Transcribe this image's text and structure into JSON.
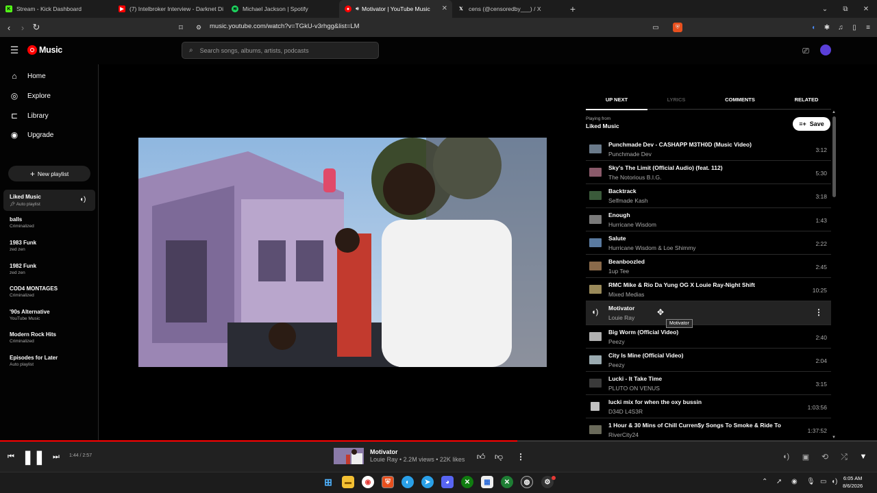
{
  "browser": {
    "tabs": [
      {
        "title": "Stream - Kick Dashboard",
        "active": false
      },
      {
        "title": "(7) Intelbroker Interview - Darknet Di",
        "active": false
      },
      {
        "title": "Michael Jackson | Spotify",
        "active": false
      },
      {
        "title": "Motivator | YouTube Music",
        "active": true
      },
      {
        "title": "cens (@censoredby___) / X",
        "active": false
      }
    ],
    "url": "music.youtube.com/watch?v=TGkU-v3rhgg&list=LM"
  },
  "header": {
    "logo_text": "Music",
    "search_placeholder": "Search songs, albums, artists, podcasts"
  },
  "sidebar": {
    "nav": [
      {
        "label": "Home",
        "icon": "home-icon"
      },
      {
        "label": "Explore",
        "icon": "explore-icon"
      },
      {
        "label": "Library",
        "icon": "library-icon"
      },
      {
        "label": "Upgrade",
        "icon": "upgrade-icon"
      }
    ],
    "new_playlist": "New playlist",
    "playlists": [
      {
        "title": "Liked Music",
        "subtitle": "Auto playlist"
      },
      {
        "title": "balls",
        "subtitle": "Criminalized"
      },
      {
        "title": "1983 Funk",
        "subtitle": "zed zen"
      },
      {
        "title": "1982 Funk",
        "subtitle": "zed zen"
      },
      {
        "title": "COD4 MONTAGES",
        "subtitle": "Criminalized"
      },
      {
        "title": "'90s Alternative",
        "subtitle": "YouTube Music"
      },
      {
        "title": "Modern Rock Hits",
        "subtitle": "Criminalized"
      },
      {
        "title": "Episodes for Later",
        "subtitle": "Auto playlist"
      }
    ]
  },
  "panel": {
    "tabs": [
      "UP NEXT",
      "LYRICS",
      "COMMENTS",
      "RELATED"
    ],
    "playing_from_label": "Playing from",
    "playing_from": "Liked Music",
    "save_label": "Save",
    "queue": [
      {
        "title": "Punchmade Dev - CASHAPP M3TH0D (Music Video)",
        "artist": "Punchmade Dev",
        "duration": "3:12"
      },
      {
        "title": "Sky's The Limit (Official Audio) (feat. 112)",
        "artist": "The Notorious B.I.G.",
        "duration": "5:30"
      },
      {
        "title": "Backtrack",
        "artist": "Selfmade Kash",
        "duration": "3:18"
      },
      {
        "title": "Enough",
        "artist": "Hurricane Wisdom",
        "duration": "1:43"
      },
      {
        "title": "Salute",
        "artist": "Hurricane Wisdom & Loe Shimmy",
        "duration": "2:22"
      },
      {
        "title": "Beanboozled",
        "artist": "1up Tee",
        "duration": "2:45"
      },
      {
        "title": "RMC Mike & Rio Da Yung OG X Louie Ray-Night Shift",
        "artist": "Mixed Medias",
        "duration": "10:25"
      },
      {
        "title": "Motivator",
        "artist": "Louie Ray",
        "duration": "",
        "playing": true
      },
      {
        "title": "Big Worm (Official Video)",
        "artist": "Peezy",
        "duration": "2:40"
      },
      {
        "title": "City Is Mine (Official Video)",
        "artist": "Peezy",
        "duration": "2:04"
      },
      {
        "title": "Lucki - It Take Time",
        "artist": "PLUTO ON VENUS",
        "duration": "3:15"
      },
      {
        "title": "lucki mix for when the oxy bussin",
        "artist": "D34D L4S3R",
        "duration": "1:03:56"
      },
      {
        "title": "1 Hour & 30 Mins of Chill Curren$y Songs To Smoke & Ride To",
        "artist": "RiverCity24",
        "duration": "1:37:52"
      }
    ],
    "tooltip": "Motivator"
  },
  "player": {
    "time": "1:44 / 2:57",
    "progress_fraction": 0.59,
    "title": "Motivator",
    "subtitle": "Louie Ray • 2.2M views • 22K likes"
  },
  "taskbar": {
    "time": "6:05 AM",
    "date": "8/6/2026"
  },
  "colors": {
    "accent": "#ff0000",
    "background": "#030303",
    "player_bar": "#212121"
  }
}
